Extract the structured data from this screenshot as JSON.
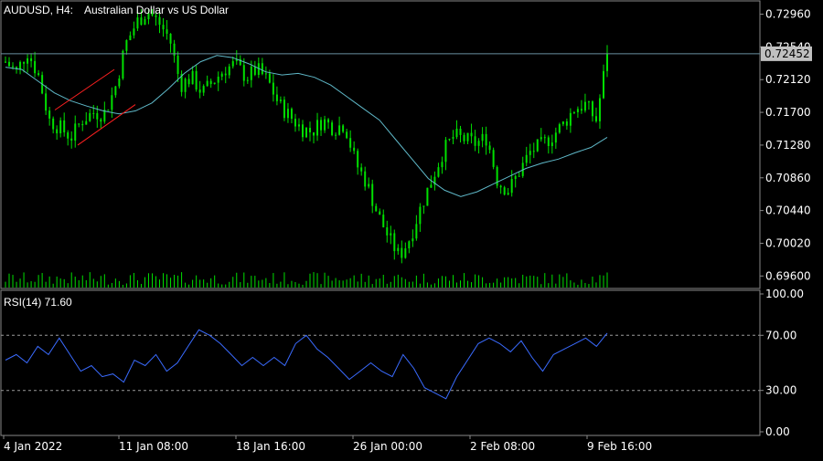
{
  "header": {
    "symbol_label": "AUDUSD, H4:",
    "description": "Australian Dollar vs US Dollar"
  },
  "rsi": {
    "label": "RSI(14) 71.60",
    "levels": [
      100,
      70,
      30,
      0
    ],
    "level_labels": [
      "100.00",
      "70.00",
      "30.00",
      "0.00"
    ]
  },
  "price_axis": {
    "ticks": [
      "0.72960",
      "0.72540",
      "0.72120",
      "0.71700",
      "0.71280",
      "0.70860",
      "0.70440",
      "0.70020",
      "0.69600"
    ],
    "current_price": "0.72452"
  },
  "time_axis": {
    "labels": [
      "4 Jan 2022",
      "11 Jan 08:00",
      "18 Jan 16:00",
      "26 Jan 00:00",
      "2 Feb 08:00",
      "9 Feb 16:00"
    ]
  },
  "colors": {
    "bull": "#00e000",
    "bear": "#00e000",
    "ma": "#5fb8c8",
    "rsi": "#3a6bff",
    "channel": "#ff2020",
    "grid_border": "#888888",
    "price_line": "#6a8fa0"
  },
  "chart_data": [
    {
      "type": "candlestick",
      "title": "AUDUSD, H4: Australian Dollar vs US Dollar",
      "ylim": [
        0.6944,
        0.7313
      ],
      "x": [
        "4 Jan 2022",
        "11 Jan 08:00",
        "18 Jan 16:00",
        "26 Jan 00:00",
        "2 Feb 08:00",
        "9 Feb 16:00"
      ],
      "close_path": [
        0.7235,
        0.7222,
        0.7248,
        0.7218,
        0.716,
        0.715,
        0.7138,
        0.716,
        0.717,
        0.7168,
        0.72,
        0.7258,
        0.7286,
        0.73,
        0.7285,
        0.7265,
        0.7205,
        0.7215,
        0.7195,
        0.721,
        0.7225,
        0.7232,
        0.7215,
        0.7225,
        0.721,
        0.718,
        0.7165,
        0.715,
        0.7145,
        0.716,
        0.715,
        0.7155,
        0.7105,
        0.708,
        0.704,
        0.701,
        0.6985,
        0.701,
        0.705,
        0.7085,
        0.712,
        0.714,
        0.7135,
        0.713,
        0.7138,
        0.708,
        0.707,
        0.7095,
        0.712,
        0.7128,
        0.714,
        0.7155,
        0.7175,
        0.718,
        0.716,
        0.7245
      ],
      "moving_average": [
        0.7228,
        0.7225,
        0.721,
        0.7195,
        0.7185,
        0.7178,
        0.7172,
        0.7168,
        0.7172,
        0.7182,
        0.72,
        0.722,
        0.7235,
        0.7243,
        0.724,
        0.7232,
        0.7222,
        0.7218,
        0.722,
        0.7215,
        0.7205,
        0.719,
        0.7175,
        0.716,
        0.7135,
        0.711,
        0.7085,
        0.707,
        0.7062,
        0.7068,
        0.7078,
        0.7088,
        0.7098,
        0.7105,
        0.711,
        0.7118,
        0.7125,
        0.7138
      ],
      "current_price": 0.72452
    },
    {
      "type": "line",
      "title": "RSI(14) 71.60",
      "ylim": [
        0,
        100
      ],
      "levels": [
        70,
        30
      ],
      "series": [
        {
          "name": "RSI(14)",
          "values": [
            52,
            56,
            50,
            62,
            56,
            68,
            56,
            44,
            48,
            40,
            42,
            36,
            52,
            48,
            56,
            44,
            50,
            62,
            74,
            70,
            64,
            56,
            48,
            54,
            48,
            54,
            48,
            64,
            70,
            60,
            54,
            46,
            38,
            44,
            50,
            44,
            40,
            56,
            46,
            32,
            28,
            24,
            40,
            52,
            64,
            68,
            64,
            58,
            66,
            54,
            44,
            56,
            60,
            64,
            68,
            62,
            71.6
          ]
        }
      ]
    }
  ]
}
